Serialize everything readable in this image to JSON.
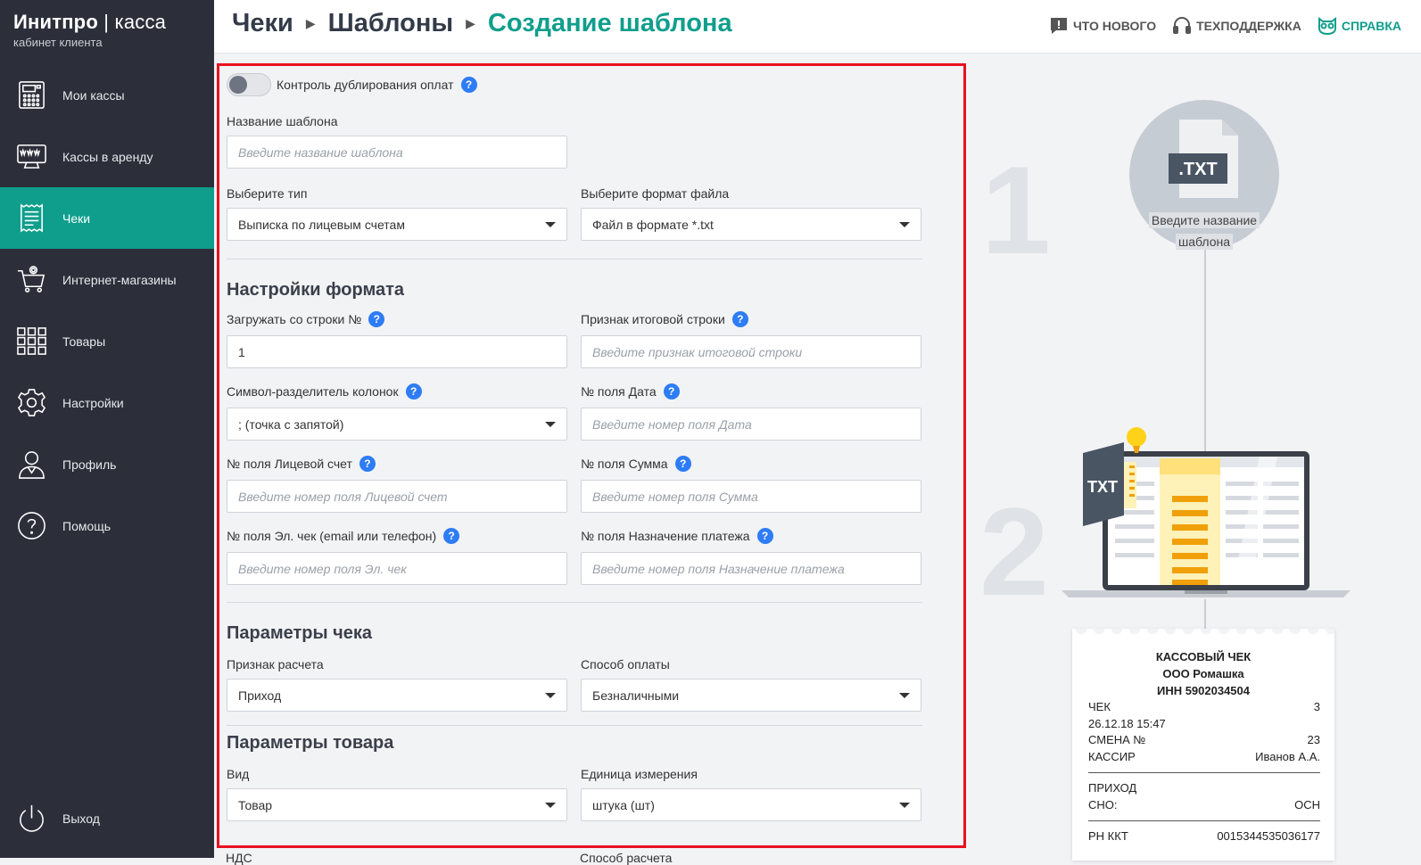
{
  "brand": {
    "name_bold": "Инитпро",
    "name_sep": "|",
    "name_thin": "касса",
    "subtitle": "кабинет клиента"
  },
  "sidebar": {
    "items": [
      {
        "label": "Мои кассы",
        "icon": "cash-register-icon"
      },
      {
        "label": "Кассы в аренду",
        "icon": "www-terminal-icon"
      },
      {
        "label": "Чеки",
        "icon": "receipt-icon",
        "active": true
      },
      {
        "label": "Интернет-магазины",
        "icon": "shopping-cart-icon"
      },
      {
        "label": "Товары",
        "icon": "grid-icon"
      },
      {
        "label": "Настройки",
        "icon": "gear-icon"
      },
      {
        "label": "Профиль",
        "icon": "user-icon"
      },
      {
        "label": "Помощь",
        "icon": "help-icon"
      }
    ],
    "logout": {
      "label": "Выход",
      "icon": "power-icon"
    }
  },
  "header": {
    "breadcrumbs": [
      "Чеки",
      "Шаблоны",
      "Создание шаблона"
    ],
    "links": [
      {
        "label": "ЧТО НОВОГО",
        "icon": "news-icon"
      },
      {
        "label": "ТЕХПОДДЕРЖКА",
        "icon": "headset-icon"
      },
      {
        "label": "СПРАВКА",
        "icon": "owl-icon"
      }
    ]
  },
  "form": {
    "duplicate_control": {
      "label": "Контроль дублирования оплат",
      "enabled": false
    },
    "template_name": {
      "label": "Название шаблона",
      "placeholder": "Введите название шаблона",
      "value": ""
    },
    "type": {
      "label": "Выберите тип",
      "value": "Выписка по лицевым счетам"
    },
    "file_format": {
      "label": "Выберите формат файла",
      "value": "Файл в формате *.txt"
    },
    "format_section": {
      "title": "Настройки формата",
      "start_row": {
        "label": "Загружать со строки №",
        "value": "1"
      },
      "total_row": {
        "label": "Признак итоговой строки",
        "placeholder": "Введите признак итоговой строки"
      },
      "separator": {
        "label": "Символ-разделитель колонок",
        "value": "; (точка с запятой)"
      },
      "date_field": {
        "label": "№ поля Дата",
        "placeholder": "Введите номер поля Дата"
      },
      "account_field": {
        "label": "№ поля Лицевой счет",
        "placeholder": "Введите номер поля Лицевой счет"
      },
      "sum_field": {
        "label": "№ поля Сумма",
        "placeholder": "Введите номер поля Сумма"
      },
      "email_field": {
        "label": "№ поля Эл. чек (email или телефон)",
        "placeholder": "Введите номер поля Эл. чек"
      },
      "purpose_field": {
        "label": "№ поля Назначение платежа",
        "placeholder": "Введите номер поля Назначение платежа"
      }
    },
    "check_section": {
      "title": "Параметры чека",
      "calc_sign": {
        "label": "Признак расчета",
        "value": "Приход"
      },
      "pay_method": {
        "label": "Способ оплаты",
        "value": "Безналичными"
      }
    },
    "goods_section": {
      "title": "Параметры товара",
      "kind": {
        "label": "Вид",
        "value": "Товар"
      },
      "unit": {
        "label": "Единица измерения",
        "value": "штука (шт)"
      },
      "next_left_label": "НДС",
      "next_right_label": "Способ расчета"
    }
  },
  "illustration": {
    "step1": "1",
    "step2": "2",
    "file_badge": ".TXT",
    "laptop_badge": "TXT",
    "circle_caption_line1": "Введите название",
    "circle_caption_line2": "шаблона",
    "receipt": {
      "title": "КАССОВЫЙ ЧЕК",
      "org": "ООО Ромашка",
      "inn": "ИНН 5902034504",
      "rows1": [
        {
          "k": "ЧЕК",
          "v": "3"
        },
        {
          "k": "26.12.18 15:47",
          "v": ""
        },
        {
          "k": "СМЕНА №",
          "v": "23"
        },
        {
          "k": "КАССИР",
          "v": "Иванов А.А."
        }
      ],
      "rows2": [
        {
          "k": "ПРИХОД",
          "v": ""
        },
        {
          "k": "СНО:",
          "v": "ОСН"
        }
      ],
      "rows3": [
        {
          "k": "РН ККТ",
          "v": "0015344535036177"
        }
      ]
    }
  },
  "colors": {
    "accent": "#0f9e8c",
    "sidebar_bg": "#2c2f3a",
    "help_icon": "#2e7cf6",
    "highlight_border": "#e8101f"
  }
}
